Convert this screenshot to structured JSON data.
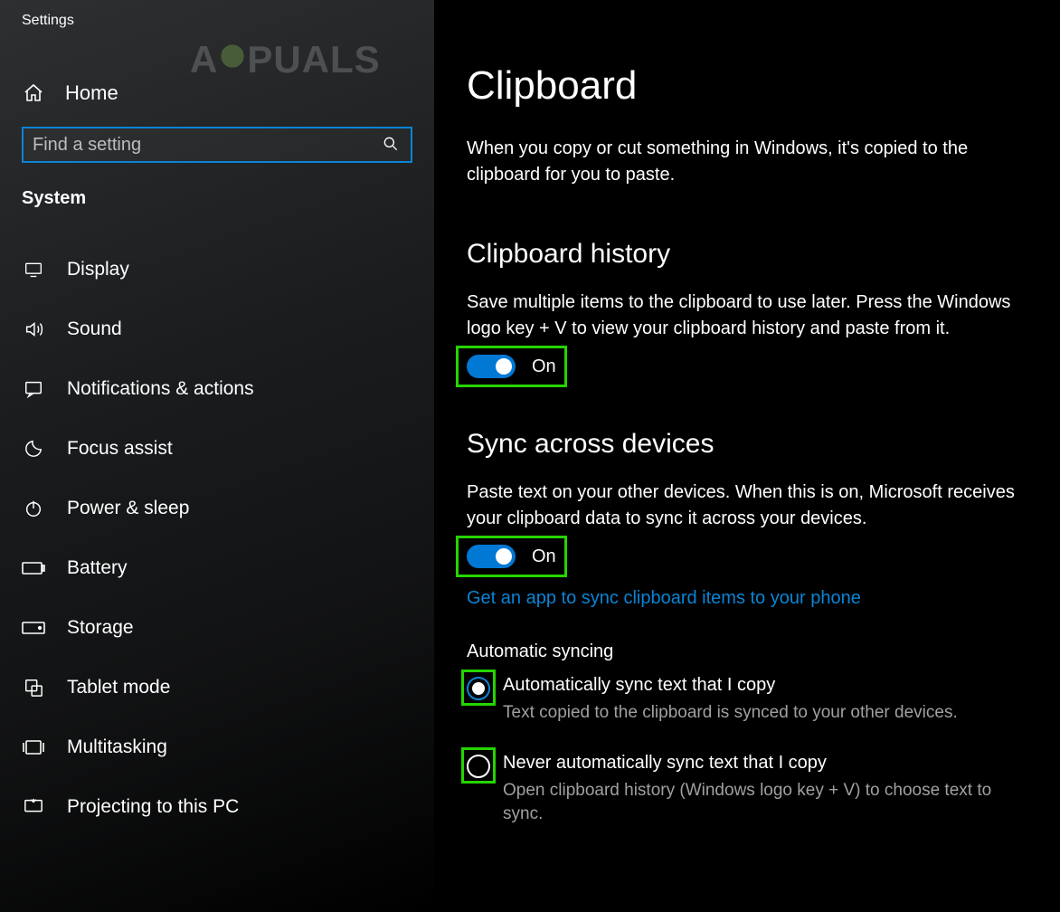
{
  "window_title": "Settings",
  "watermark": {
    "left": "A",
    "right": "PUALS"
  },
  "home_label": "Home",
  "search": {
    "placeholder": "Find a setting"
  },
  "section_label": "System",
  "nav": [
    {
      "icon": "display-icon",
      "label": "Display"
    },
    {
      "icon": "sound-icon",
      "label": "Sound"
    },
    {
      "icon": "notifications-icon",
      "label": "Notifications & actions"
    },
    {
      "icon": "focus-assist-icon",
      "label": "Focus assist"
    },
    {
      "icon": "power-icon",
      "label": "Power & sleep"
    },
    {
      "icon": "battery-icon",
      "label": "Battery"
    },
    {
      "icon": "storage-icon",
      "label": "Storage"
    },
    {
      "icon": "tablet-icon",
      "label": "Tablet mode"
    },
    {
      "icon": "multitask-icon",
      "label": "Multitasking"
    },
    {
      "icon": "projecting-icon",
      "label": "Projecting to this PC"
    }
  ],
  "main": {
    "title": "Clipboard",
    "intro": "When you copy or cut something in Windows, it's copied to the clipboard for you to paste.",
    "history": {
      "heading": "Clipboard history",
      "desc": "Save multiple items to the clipboard to use later. Press the Windows logo key + V to view your clipboard history and paste from it.",
      "toggle_state": "On"
    },
    "sync": {
      "heading": "Sync across devices",
      "desc": "Paste text on your other devices. When this is on, Microsoft receives your clipboard data to sync it across your devices.",
      "toggle_state": "On",
      "link": "Get an app to sync clipboard items to your phone",
      "auto_heading": "Automatic syncing",
      "options": [
        {
          "label": "Automatically sync text that I copy",
          "desc": "Text copied to the clipboard is synced to your other devices.",
          "checked": true
        },
        {
          "label": "Never automatically sync text that I copy",
          "desc": "Open clipboard history (Windows logo key + V) to choose text to sync.",
          "checked": false
        }
      ]
    }
  }
}
